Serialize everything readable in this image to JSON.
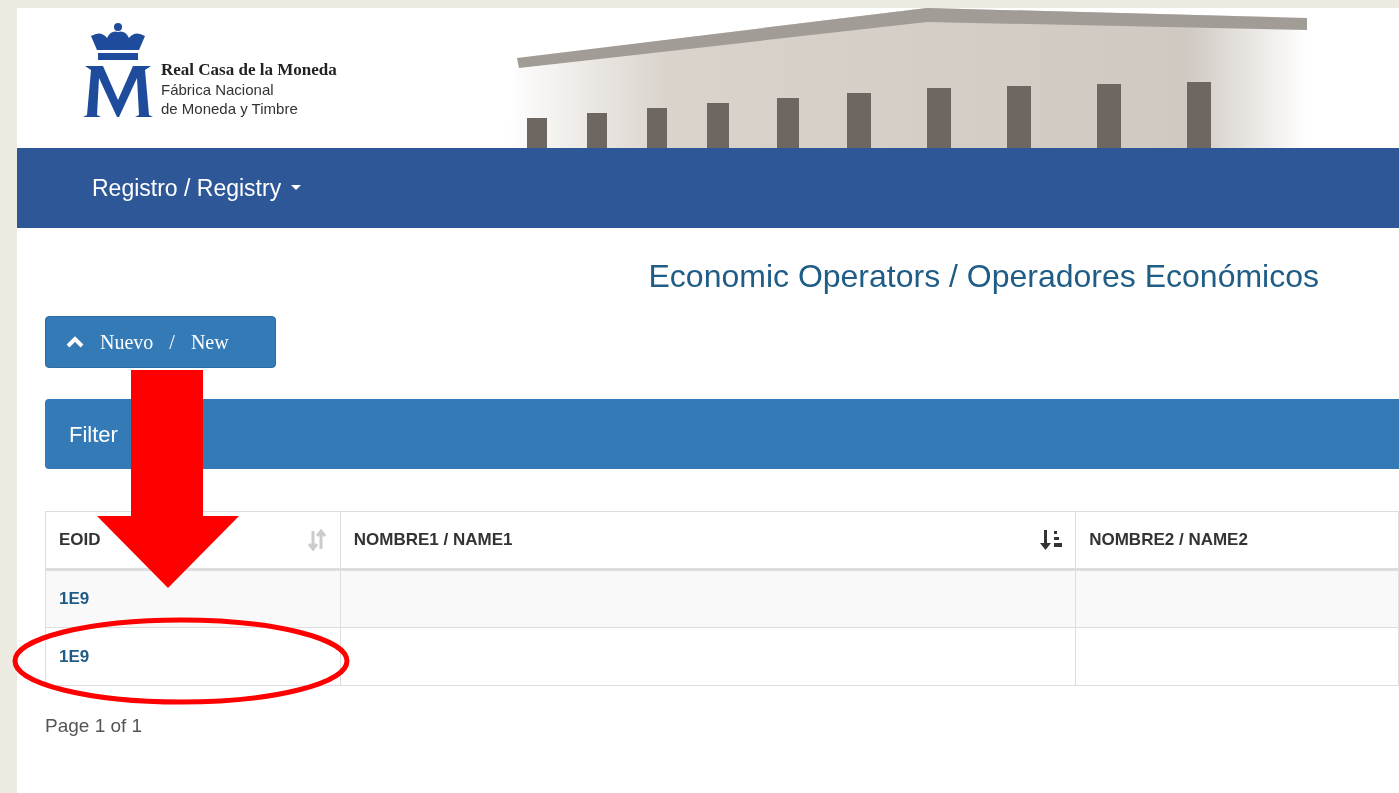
{
  "header": {
    "logo": {
      "title": "Real Casa de la Moneda",
      "subtitle_1": "Fábrica Nacional",
      "subtitle_2": "de Moneda y Timbre"
    }
  },
  "navbar": {
    "items": [
      {
        "label": "Registro / Registry",
        "dropdown": true
      }
    ]
  },
  "page_title": "Economic Operators / Operadores Económicos",
  "new_button": {
    "label_1": "Nuevo",
    "separator": "/",
    "label_2": "New"
  },
  "filter_panel": {
    "title": "Filter"
  },
  "table": {
    "columns": [
      {
        "label": "EOID",
        "sortable": true,
        "sorted": false
      },
      {
        "label": "NOMBRE1 / NAME1",
        "sortable": true,
        "sorted": true
      },
      {
        "label": "NOMBRE2 / NAME2",
        "sortable": false
      }
    ],
    "rows": [
      {
        "eoid": "1E9"
      },
      {
        "eoid": "1E9"
      }
    ]
  },
  "pagination": "Page 1 of 1",
  "annotations": {
    "arrow": true,
    "ellipse": true
  }
}
